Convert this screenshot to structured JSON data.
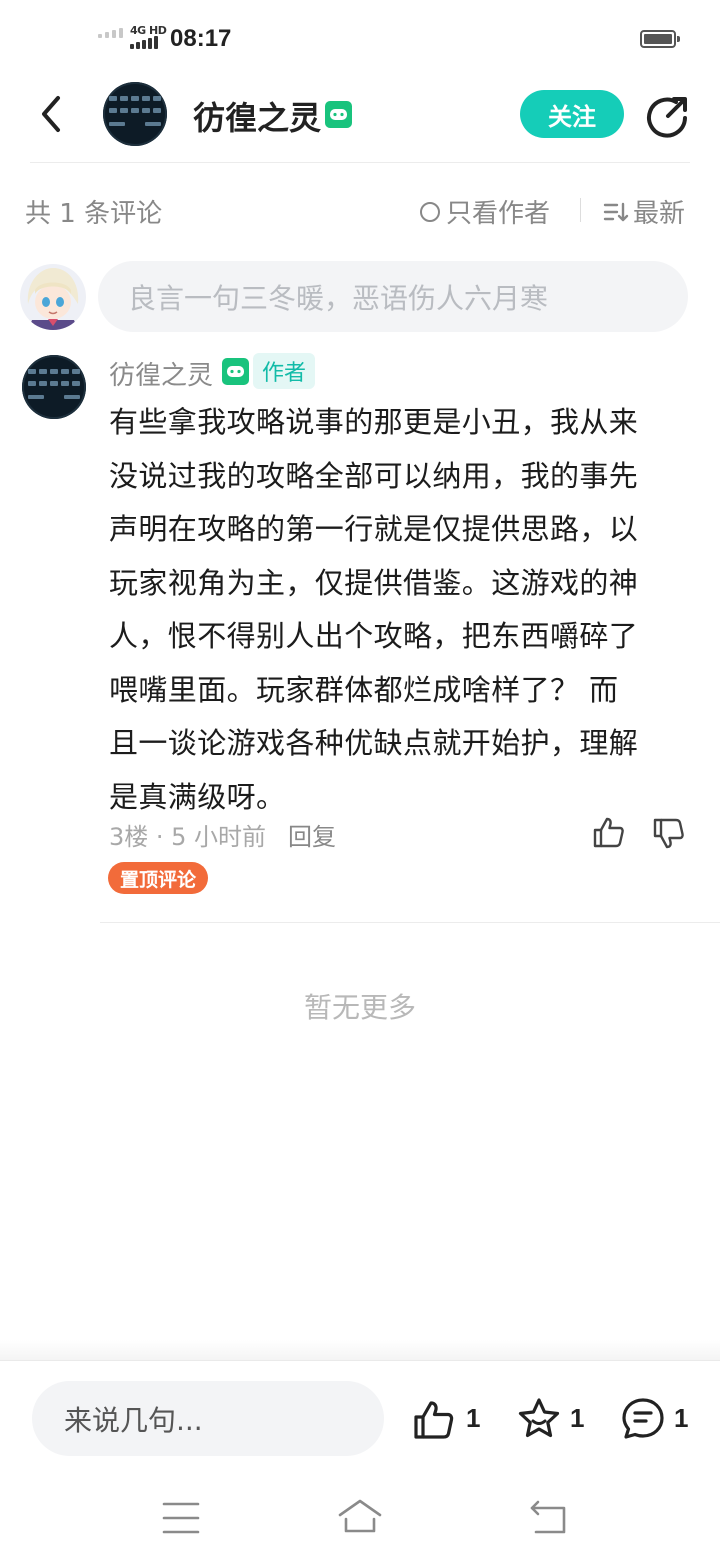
{
  "status_bar": {
    "network": "4G HD",
    "time": "08:17"
  },
  "header": {
    "author_name": "彷徨之灵",
    "follow_label": "关注",
    "colors": {
      "accent": "#15cdb8",
      "badge": "#19c37d"
    }
  },
  "toolbar": {
    "comment_count": "共 1 条评论",
    "only_author_label": "只看作者",
    "sort_label": "最新"
  },
  "comment_input": {
    "placeholder": "良言一句三冬暖，恶语伤人六月寒"
  },
  "comments": [
    {
      "author": "彷徨之灵",
      "author_tag": "作者",
      "lines": [
        "有些拿我攻略说事的那更是小丑，我从来",
        "没说过我的攻略全部可以纳用，我的事先",
        "声明在攻略的第一行就是仅提供思路，以",
        "玩家视角为主，仅提供借鉴。这游戏的神",
        "人，恨不得别人出个攻略，把东西嚼碎了",
        "喂嘴里面。玩家群体都烂成啥样了？ 而",
        "且一谈论游戏各种优缺点就开始护，理解",
        "是真满级呀。"
      ],
      "meta": "3楼 · 5 小时前",
      "reply_label": "回复",
      "pinned_label": "置顶评论"
    }
  ],
  "no_more_text": "暂无更多",
  "bottom_bar": {
    "input_placeholder": "来说几句...",
    "like_count": "1",
    "favorite_count": "1",
    "comment_count": "1"
  }
}
